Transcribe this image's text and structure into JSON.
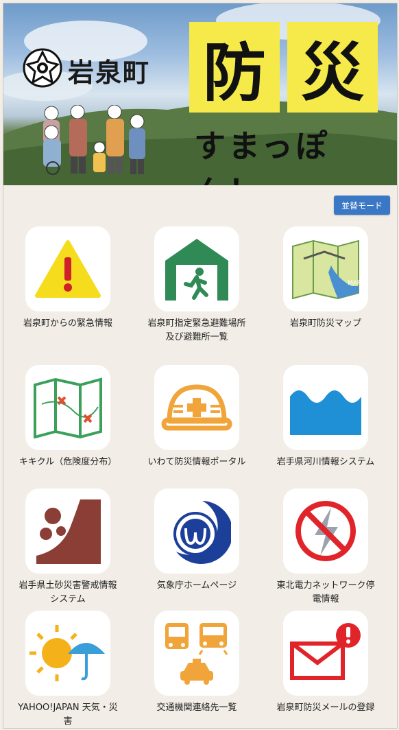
{
  "header": {
    "town_name": "岩泉町",
    "bosai_char1": "防",
    "bosai_char2": "災",
    "subtitle": "すまっぽん！"
  },
  "toolbar": {
    "sort_label": "並替モード"
  },
  "tiles": [
    {
      "label": "岩泉町からの緊急情報",
      "icon": "warning-icon"
    },
    {
      "label": "岩泉町指定緊急避難場所及び避難所一覧",
      "icon": "evacuation-icon"
    },
    {
      "label": "岩泉町防災マップ",
      "icon": "map-icon"
    },
    {
      "label": "キキクル（危険度分布）",
      "icon": "hazard-map-icon"
    },
    {
      "label": "いわて防災情報ポータル",
      "icon": "helmet-icon"
    },
    {
      "label": "岩手県河川情報システム",
      "icon": "river-icon"
    },
    {
      "label": "岩手県土砂災害警戒情報システム",
      "icon": "landslide-icon"
    },
    {
      "label": "気象庁ホームページ",
      "icon": "jma-logo-icon"
    },
    {
      "label": "東北電力ネットワーク停電情報",
      "icon": "power-outage-icon"
    },
    {
      "label": "YAHOO!JAPAN 天気・災害",
      "icon": "weather-icon"
    },
    {
      "label": "交通機関連絡先一覧",
      "icon": "transport-icon"
    },
    {
      "label": "岩泉町防災メールの登録",
      "icon": "mail-alert-icon"
    }
  ],
  "colors": {
    "background": "#f2eee7",
    "button": "#3a77c4",
    "highlight_yellow": "#f5ea4a"
  }
}
